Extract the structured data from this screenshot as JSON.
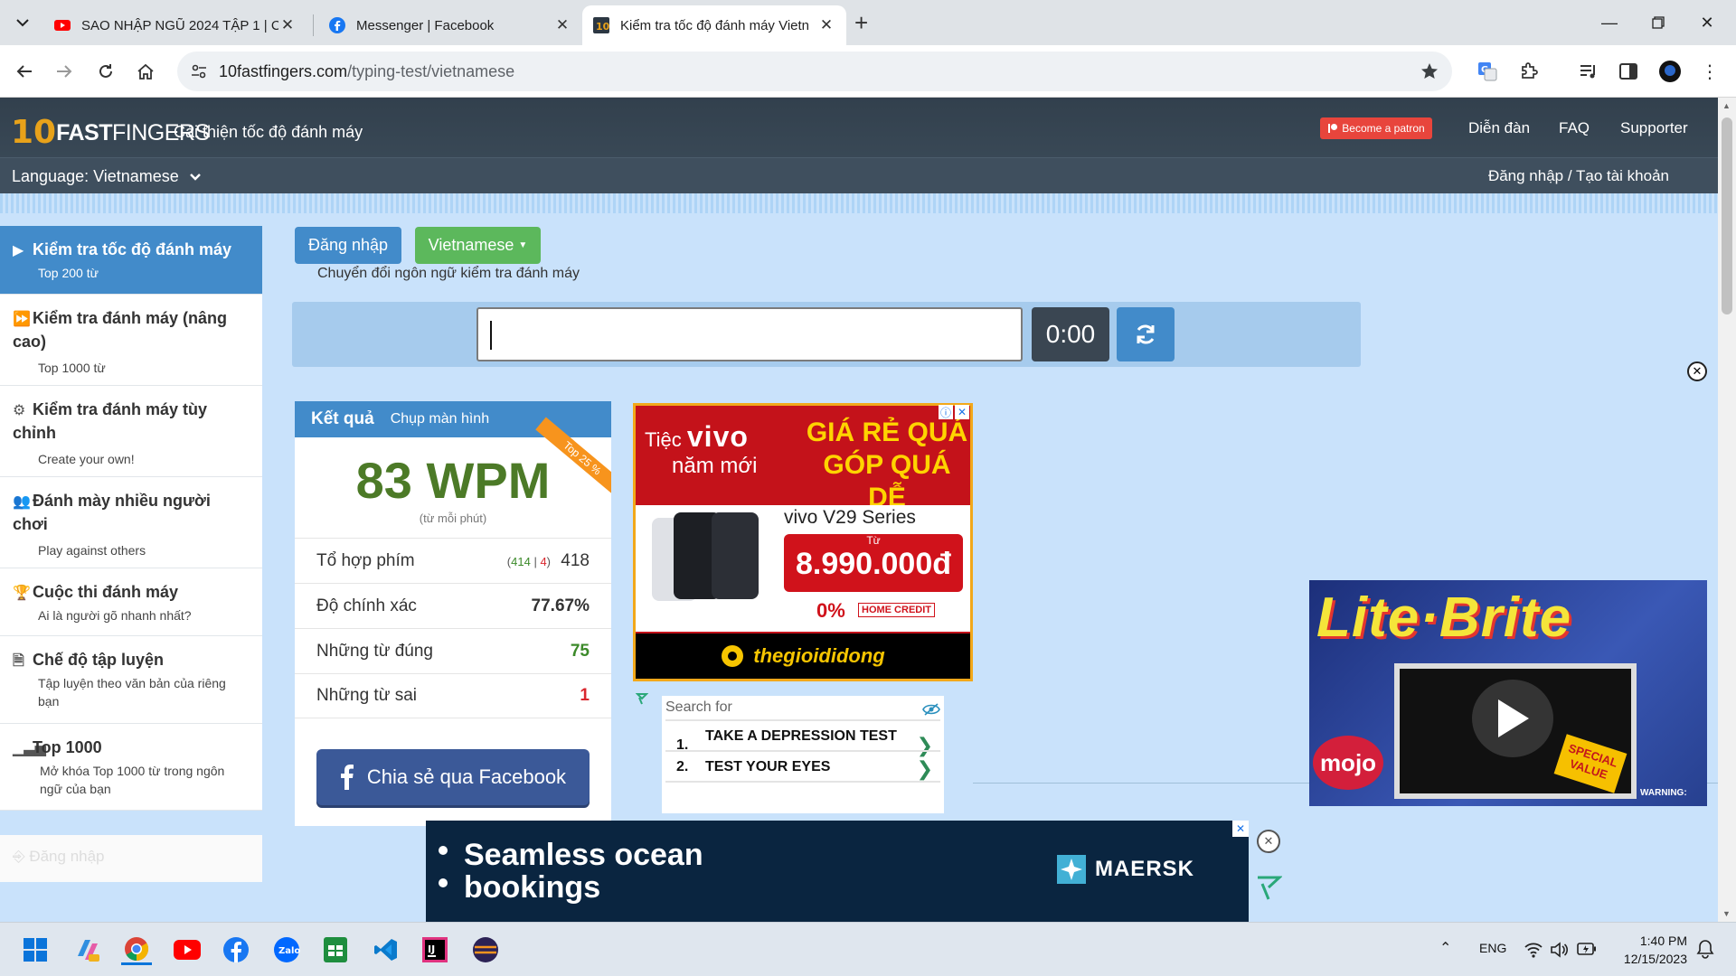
{
  "browser": {
    "tabs": [
      {
        "title": "SAO NHẬP NGŨ 2024 TẬP 1 | C",
        "icon": "youtube-icon",
        "active": false
      },
      {
        "title": "Messenger | Facebook",
        "icon": "facebook-icon",
        "active": false
      },
      {
        "title": "Kiểm tra tốc độ đánh máy Vietn",
        "icon": "10fastfingers-icon",
        "active": true
      }
    ],
    "url_host": "10fastfingers.com",
    "url_path": "/typing-test/vietnamese"
  },
  "site": {
    "logo_ten": "10",
    "logo_fast": "FAST",
    "logo_fingers": "FINGERS",
    "tagline": "Cải thiện tốc độ đánh máy",
    "patron": "Become a patron",
    "nav": [
      "Diễn đàn",
      "FAQ",
      "Supporter"
    ],
    "language_label": "Language: Vietnamese",
    "login_link": "Đăng nhập / Tạo tài khoản"
  },
  "sidebar": {
    "items": [
      {
        "title": "Kiểm tra tốc độ đánh máy",
        "sub": "Top 200 từ",
        "icon": "play-icon"
      },
      {
        "title": "Kiểm tra đánh máy (nâng cao)",
        "sub": "Top 1000 từ",
        "icon": "fast-forward-icon"
      },
      {
        "title": "Kiểm tra đánh máy tùy chỉnh",
        "sub": "Create your own!",
        "icon": "gears-icon"
      },
      {
        "title": "Đánh mày nhiều người chơi",
        "sub": "Play against others",
        "icon": "users-icon"
      },
      {
        "title": "Cuộc thi đánh máy",
        "sub": "Ai là người gõ nhanh nhất?",
        "icon": "trophy-icon"
      },
      {
        "title": "Chế độ tập luyện",
        "sub": "Tập luyện theo văn bản của riêng bạn",
        "icon": "document-icon"
      },
      {
        "title": "Top 1000",
        "sub": "Mở khóa Top 1000 từ trong ngôn ngữ của bạn",
        "icon": "signal-icon"
      }
    ],
    "login": "Đăng nhập"
  },
  "main": {
    "login_button": "Đăng nhập",
    "language_button": "Vietnamese",
    "switch_hint": "Chuyển đổi ngôn ngữ kiểm tra đánh máy",
    "timer": "0:00"
  },
  "results": {
    "title": "Kết quả",
    "screenshot": "Chụp màn hình",
    "ribbon": "Top 25 %",
    "wpm": "83 WPM",
    "wpm_sub": "(từ mỗi phút)",
    "keystrokes_label": "Tổ hợp phím",
    "keystrokes_correct": "414",
    "keystrokes_wrong": "4",
    "keystrokes_total": "418",
    "accuracy_label": "Độ chính xác",
    "accuracy": "77.67%",
    "correct_label": "Những từ đúng",
    "correct": "75",
    "wrong_label": "Những từ sai",
    "wrong": "1",
    "share": "Chia sẻ qua Facebook"
  },
  "ads": {
    "vivo": {
      "tiec": "Tiệc",
      "vivo": "vivo",
      "nam_moi": "năm mới",
      "line1": "GIÁ RẺ QUÁ",
      "line2": "GÓP QUÁ DỄ",
      "series": "vivo V29 Series",
      "tu": "Từ",
      "price": "8.990.000đ",
      "installment": "0%",
      "home_credit": "HOME CREDIT",
      "store": "thegioididong"
    },
    "search": {
      "header": "Search for",
      "items": [
        {
          "num": "1.",
          "text": "TAKE A DEPRESSION TEST"
        },
        {
          "num": "2.",
          "text": "TEST YOUR EYES"
        }
      ]
    },
    "video": {
      "title": "Lite·Brite",
      "badge": "SPECIAL VALUE",
      "brand": "mojo",
      "warning": "WARNING:"
    },
    "maersk": {
      "line1": "Seamless ocean",
      "line2": "bookings",
      "brand": "MAERSK"
    }
  },
  "taskbar": {
    "lang": "ENG",
    "time": "1:40 PM",
    "date": "12/15/2023",
    "apps": [
      "windows-start-icon",
      "copilot-icon",
      "chrome-icon",
      "youtube-icon",
      "facebook-icon",
      "zalo-icon",
      "sheets-icon",
      "vscode-icon",
      "intellij-icon",
      "eclipse-icon"
    ]
  },
  "colors": {
    "primary": "#428bca",
    "success": "#5cb85c",
    "header": "#32404d",
    "page_bg": "#c9e2fb",
    "wpm_green": "#4c7a27"
  }
}
